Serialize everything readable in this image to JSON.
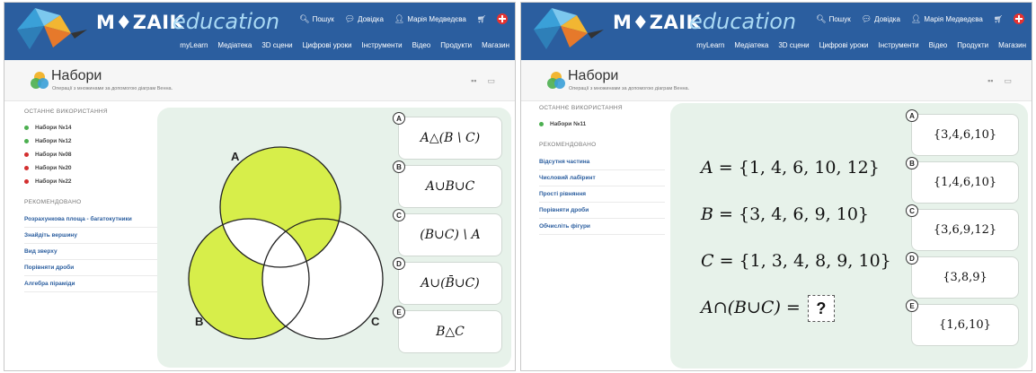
{
  "header": {
    "logo_main": "M♦ZAIK",
    "logo_sub": "education",
    "top_links": [
      "Пошук",
      "Довідка",
      "Марія Медведєва"
    ],
    "nav": [
      "myLearn",
      "Медіатека",
      "3D сцени",
      "Цифрові уроки",
      "Інструменти",
      "Відео",
      "Продукти",
      "Магазин"
    ]
  },
  "page": {
    "title": "Набори",
    "subtitle": "Операції з множинами за допомогою діаграм Венна."
  },
  "sidebar": {
    "recent_title": "ОСТАННЄ ВИКОРИСТАННЯ",
    "recommended_title": "РЕКОМЕНДОВАНО"
  },
  "left": {
    "recent": [
      {
        "label": "Набори №14",
        "color": "#4caf50"
      },
      {
        "label": "Набори №12",
        "color": "#4caf50"
      },
      {
        "label": "Набори №08",
        "color": "#d32f2f"
      },
      {
        "label": "Набори №20",
        "color": "#d32f2f"
      },
      {
        "label": "Набори №22",
        "color": "#d32f2f"
      }
    ],
    "recommended": [
      "Розрахункова площа - багатокутники",
      "Знайдіть вершину",
      "Вид зверху",
      "Порівняти дроби",
      "Алгебра піраміди"
    ],
    "venn_labels": [
      "A",
      "B",
      "C"
    ],
    "answers": [
      {
        "letter": "A",
        "text": "A△(B \\ C)"
      },
      {
        "letter": "B",
        "text": "A∪B∪C"
      },
      {
        "letter": "C",
        "text": "(B∪C) \\ A"
      },
      {
        "letter": "D",
        "text": "A∪(B̄∪C)"
      },
      {
        "letter": "E",
        "text": "B△C"
      }
    ]
  },
  "right": {
    "recent": [
      {
        "label": "Набори №11",
        "color": "#4caf50"
      }
    ],
    "recommended": [
      "Відсутня частина",
      "Числовий лабіринт",
      "Прості рівняння",
      "Порівняти дроби",
      "Обчисліть фігури"
    ],
    "equations": [
      {
        "name": "A",
        "value": "= {1, 4, 6, 10, 12}"
      },
      {
        "name": "B",
        "value": "= {3, 4, 6, 9, 10}"
      },
      {
        "name": "C",
        "value": "= {1, 3, 4, 8, 9, 10}"
      }
    ],
    "question": "A∩(B∪C) =",
    "question_mark": "?",
    "answers": [
      {
        "letter": "A",
        "text": "{3,4,6,10}"
      },
      {
        "letter": "B",
        "text": "{1,4,6,10}"
      },
      {
        "letter": "C",
        "text": "{3,6,9,12}"
      },
      {
        "letter": "D",
        "text": "{3,8,9}"
      },
      {
        "letter": "E",
        "text": "{1,6,10}"
      }
    ]
  },
  "colors": {
    "header": "#2b5e9f",
    "venn_fill": "#d7ee4a",
    "exercise_bg": "#e7f2ea"
  }
}
